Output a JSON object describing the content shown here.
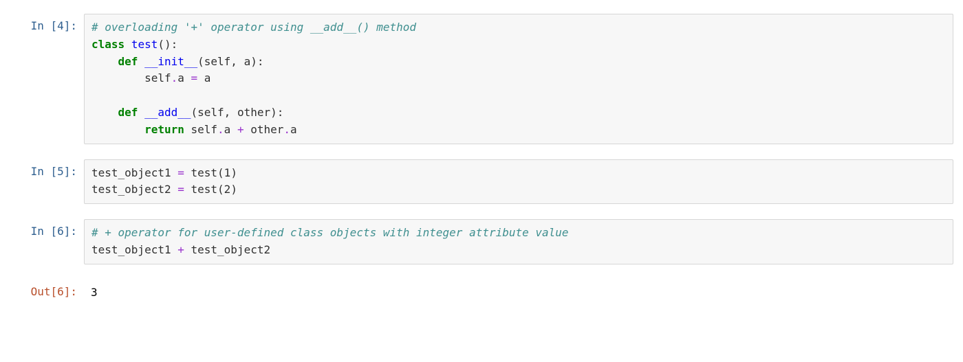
{
  "cells": [
    {
      "prompt": "In [4]:",
      "type": "in",
      "code": [
        [
          {
            "t": "# overloading '+' operator using __add__() method",
            "c": "cm"
          }
        ],
        [
          {
            "t": "class",
            "c": "kw"
          },
          {
            "t": " ",
            "c": "pn"
          },
          {
            "t": "test",
            "c": "fn"
          },
          {
            "t": "():",
            "c": "pn"
          }
        ],
        [
          {
            "t": "    ",
            "c": "pn"
          },
          {
            "t": "def",
            "c": "kw"
          },
          {
            "t": " ",
            "c": "pn"
          },
          {
            "t": "__init__",
            "c": "fn"
          },
          {
            "t": "(self, a):",
            "c": "pn"
          }
        ],
        [
          {
            "t": "        self",
            "c": "pn"
          },
          {
            "t": ".",
            "c": "op"
          },
          {
            "t": "a ",
            "c": "pn"
          },
          {
            "t": "=",
            "c": "op"
          },
          {
            "t": " a",
            "c": "pn"
          }
        ],
        [
          {
            "t": "",
            "c": "pn"
          }
        ],
        [
          {
            "t": "    ",
            "c": "pn"
          },
          {
            "t": "def",
            "c": "kw"
          },
          {
            "t": " ",
            "c": "pn"
          },
          {
            "t": "__add__",
            "c": "fn"
          },
          {
            "t": "(self, other):",
            "c": "pn"
          }
        ],
        [
          {
            "t": "        ",
            "c": "pn"
          },
          {
            "t": "return",
            "c": "kw"
          },
          {
            "t": " self",
            "c": "pn"
          },
          {
            "t": ".",
            "c": "op"
          },
          {
            "t": "a ",
            "c": "pn"
          },
          {
            "t": "+",
            "c": "op"
          },
          {
            "t": " other",
            "c": "pn"
          },
          {
            "t": ".",
            "c": "op"
          },
          {
            "t": "a",
            "c": "pn"
          }
        ]
      ]
    },
    {
      "prompt": "In [5]:",
      "type": "in",
      "code": [
        [
          {
            "t": "test_object1 ",
            "c": "pn"
          },
          {
            "t": "=",
            "c": "op"
          },
          {
            "t": " test(",
            "c": "pn"
          },
          {
            "t": "1",
            "c": "pn"
          },
          {
            "t": ")",
            "c": "pn"
          }
        ],
        [
          {
            "t": "test_object2 ",
            "c": "pn"
          },
          {
            "t": "=",
            "c": "op"
          },
          {
            "t": " test(",
            "c": "pn"
          },
          {
            "t": "2",
            "c": "pn"
          },
          {
            "t": ")",
            "c": "pn"
          }
        ]
      ]
    },
    {
      "prompt": "In [6]:",
      "type": "in",
      "code": [
        [
          {
            "t": "# + operator for user-defined class objects with integer attribute value",
            "c": "cm"
          }
        ],
        [
          {
            "t": "test_object1 ",
            "c": "pn"
          },
          {
            "t": "+",
            "c": "op"
          },
          {
            "t": " test_object2",
            "c": "pn"
          }
        ]
      ]
    },
    {
      "prompt": "Out[6]:",
      "type": "out",
      "output": "3"
    }
  ]
}
